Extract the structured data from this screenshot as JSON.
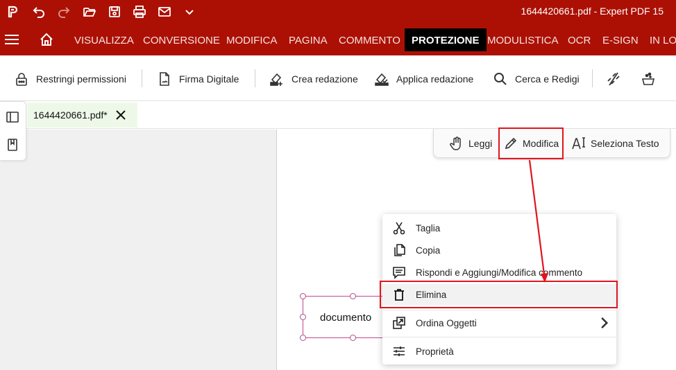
{
  "titlebar": {
    "document_title": "1644420661.pdf  -  Expert PDF 15",
    "icons": [
      "app-logo-icon",
      "undo-icon",
      "redo-icon",
      "open-folder-icon",
      "save-icon",
      "print-icon",
      "email-icon",
      "chevron-down-icon"
    ]
  },
  "ribbon": {
    "tabs": [
      {
        "label": "VISUALIZZA"
      },
      {
        "label": "CONVERSIONE"
      },
      {
        "label": "MODIFICA"
      },
      {
        "label": "PAGINA"
      },
      {
        "label": "COMMENTO"
      },
      {
        "label": "PROTEZIONE",
        "active": true
      },
      {
        "label": "MODULISTICA"
      },
      {
        "label": "OCR"
      },
      {
        "label": "E-SIGN"
      },
      {
        "label": "IN LOTTI"
      }
    ]
  },
  "toolbar": {
    "items": [
      {
        "label": "Restringi permissioni",
        "icon": "lock-icon"
      },
      {
        "label": "Firma Digitale",
        "icon": "signature-icon"
      },
      {
        "label": "Crea redazione",
        "icon": "create-redaction-icon"
      },
      {
        "label": "Applica redazione",
        "icon": "apply-redaction-icon"
      },
      {
        "label": "Cerca e Redigi",
        "icon": "search-icon"
      }
    ],
    "extra_icons": [
      "unlink-icon",
      "cleanup-icon"
    ]
  },
  "doc_tab": {
    "label": "1644420661.pdf*"
  },
  "modebar": {
    "read_label": "Leggi",
    "edit_label": "Modifica",
    "select_text_label": "Seleziona Testo"
  },
  "page": {
    "textbox_text": "documento"
  },
  "context_menu": {
    "items": [
      {
        "label": "Taglia",
        "icon": "scissors-icon"
      },
      {
        "label": "Copia",
        "icon": "copy-icon"
      },
      {
        "label": "Rispondi e Aggiungi/Modifica commento",
        "icon": "comment-icon"
      },
      {
        "label": "Elimina",
        "icon": "trash-icon",
        "highlighted": true
      },
      {
        "label": "Ordina Oggetti",
        "icon": "arrange-icon",
        "has_submenu": true
      },
      {
        "label": "Proprietà",
        "icon": "properties-icon"
      }
    ]
  },
  "colors": {
    "brand_red": "#ac1004",
    "active_tab": "#000000",
    "annotation_red": "#e0141e",
    "doc_tab_bg": "#eef8e8"
  }
}
